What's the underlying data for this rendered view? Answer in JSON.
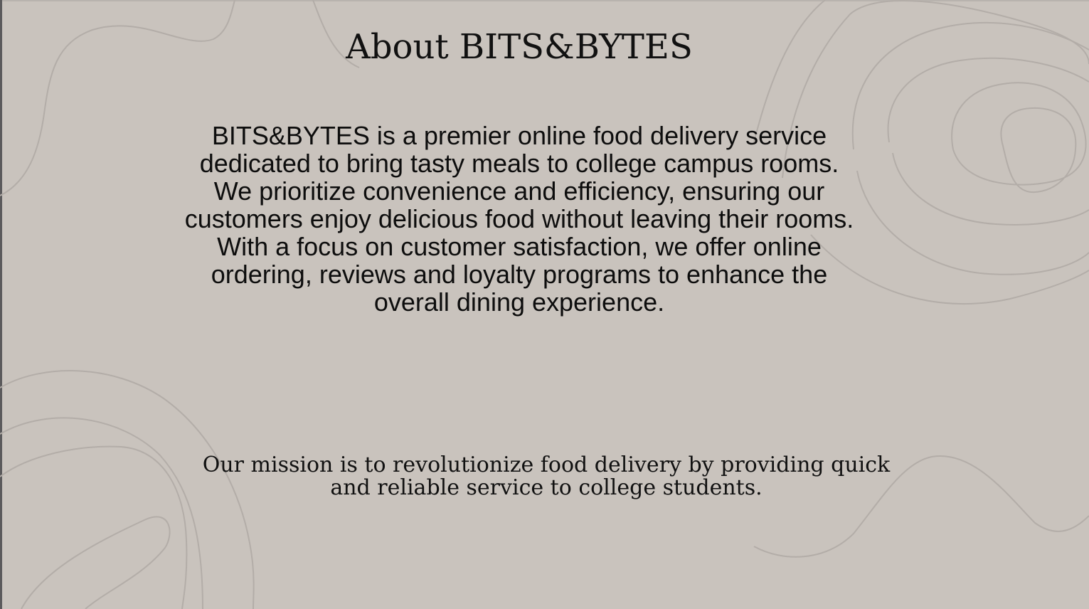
{
  "page": {
    "title": "About BITS&BYTES",
    "description": "BITS&BYTES is a premier online food delivery service dedicated to bring tasty meals to college campus rooms. We prioritize convenience and efficiency, ensuring our customers enjoy delicious food without leaving their rooms. With a focus on customer satisfaction, we offer online ordering, reviews and loyalty programs to enhance the overall dining experience.",
    "mission": "Our mission is to revolutionize food delivery by providing quick and reliable service to college students."
  },
  "colors": {
    "background": "#c9c3bd",
    "contour_lines": "#b3ada8",
    "text": "#111111"
  }
}
